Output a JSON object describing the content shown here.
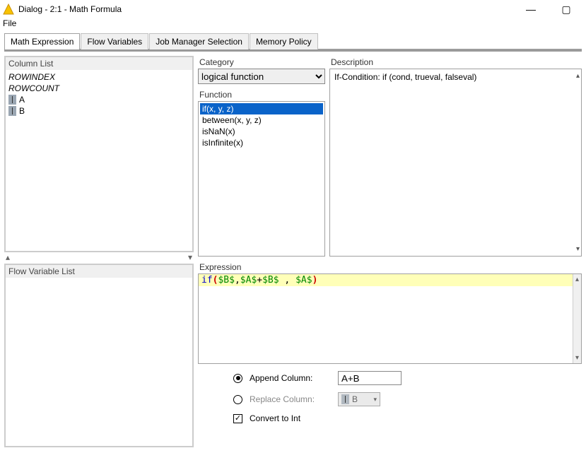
{
  "window": {
    "title": "Dialog - 2:1 - Math Formula"
  },
  "menubar": {
    "file": "File"
  },
  "tabs": [
    {
      "label": "Math Expression",
      "active": true
    },
    {
      "label": "Flow Variables"
    },
    {
      "label": "Job Manager Selection"
    },
    {
      "label": "Memory Policy"
    }
  ],
  "columnList": {
    "title": "Column List",
    "items": [
      {
        "label": "ROWINDEX",
        "special": true
      },
      {
        "label": "ROWCOUNT",
        "special": true
      },
      {
        "label": "A",
        "special": false
      },
      {
        "label": "B",
        "special": false
      }
    ]
  },
  "flowVarList": {
    "title": "Flow Variable List"
  },
  "category": {
    "label": "Category",
    "selected": "logical function"
  },
  "function": {
    "label": "Function",
    "items": [
      {
        "label": "if(x, y, z)",
        "selected": true
      },
      {
        "label": "between(x, y, z)"
      },
      {
        "label": "isNaN(x)"
      },
      {
        "label": "isInfinite(x)"
      }
    ]
  },
  "description": {
    "label": "Description",
    "text": "If-Condition: if (cond, trueval, falseval)"
  },
  "expression": {
    "label": "Expression",
    "code_parts": {
      "kw": "if",
      "op1": "(",
      "v1": "$B$",
      "c1": ",",
      "v2": "$A$",
      "plus": "+",
      "v3": "$B$",
      "sp": " , ",
      "v4": "$A$",
      "cp1": ")"
    }
  },
  "options": {
    "append": {
      "label": "Append Column:",
      "value": "A+B",
      "selected": true
    },
    "replace": {
      "label": "Replace Column:",
      "value": "B",
      "selected": false
    },
    "convert": {
      "label": "Convert to Int",
      "checked": true
    }
  }
}
